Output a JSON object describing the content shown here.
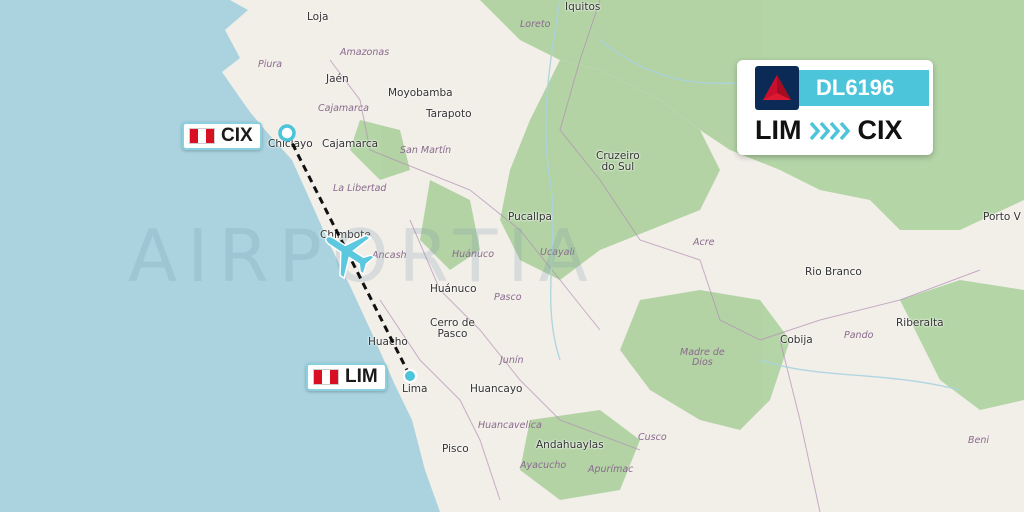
{
  "flight": {
    "number": "DL6196",
    "origin": "LIM",
    "destination": "CIX",
    "airline_logo": "delta-logo",
    "band_color": "#4cc4d9"
  },
  "airports": {
    "origin": {
      "code": "LIM",
      "flag": "peru-flag",
      "marker_color": "#4cc4d9"
    },
    "destination": {
      "code": "CIX",
      "flag": "peru-flag",
      "marker_color": "#4cc4d9"
    }
  },
  "watermark": "AIRPORTIA",
  "map_labels": {
    "iquitos": "Iquitos",
    "loja": "Loja",
    "amazonas": "Amazonas",
    "loreto": "Loreto",
    "piura": "Piura",
    "jaen": "Jaén",
    "moyobamba": "Moyobamba",
    "cajamarca_region": "Cajamarca",
    "tarapoto": "Tarapoto",
    "chiclayo": "Chiclayo",
    "cajamarca": "Cajamarca",
    "san_martin": "San Martín",
    "cruzeiro": "Cruzeiro\ndo Sul",
    "la_libertad": "La Libertad",
    "chimbote": "Chimbote",
    "pucallpa": "Pucallpa",
    "porto_velho": "Porto V",
    "ucayali": "Ucayali",
    "acre": "Acre",
    "ancash": "Ancash",
    "huanuco_region": "Huánuco",
    "rio_branco": "Rio Branco",
    "huanuco": "Huánuco",
    "pasco_region": "Pasco",
    "riberalta": "Riberalta",
    "pando": "Pando",
    "cerro_de_pasco": "Cerro de\nPasco",
    "cobija": "Cobija",
    "huacho": "Huacho",
    "madre_de_dios": "Madre de\nDios",
    "junin": "Junín",
    "lima": "Lima",
    "huancayo": "Huancayo",
    "beni": "Beni",
    "huancavelica": "Huancavelica",
    "cusco": "Cusco",
    "pisco": "Pisco",
    "andahuaylas": "Andahuaylas",
    "ayacucho": "Ayacucho",
    "apurimac": "Apurímac"
  },
  "colors": {
    "sea": "#aad3df",
    "land": "#f2efe9",
    "forest": "#add19e",
    "route": "#111111",
    "plane": "#5bc8e0"
  }
}
